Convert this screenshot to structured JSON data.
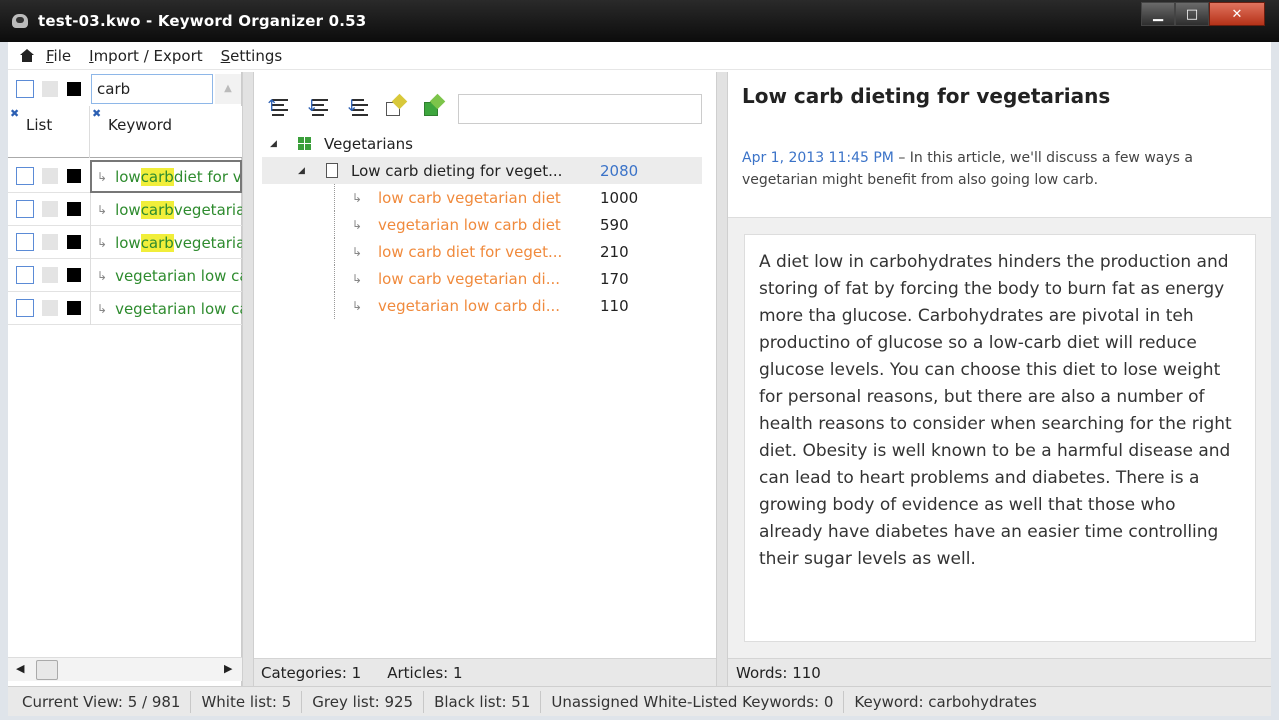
{
  "window": {
    "title": "test-03.kwo - Keyword Organizer 0.53",
    "minimize_glyph": "▁",
    "maximize_glyph": "□",
    "close_glyph": "✕"
  },
  "menu": [
    "File",
    "Import / Export",
    "Settings"
  ],
  "icons": {
    "app": "app-icon",
    "home": "home-icon",
    "sort_asc": "sort-ascending-icon",
    "sort_desc": "sort-descending-icon",
    "sort_numeric": "sort-numeric-icon",
    "add_article": "add-article-icon",
    "add_category": "add-category-icon"
  },
  "left": {
    "filter_value": "carb",
    "columns": {
      "list": "List",
      "keyword": "Keyword"
    },
    "rows": [
      {
        "pre": "low ",
        "hl": "carb",
        "post": " diet for vegetarians",
        "selected": true
      },
      {
        "pre": "low ",
        "hl": "carb",
        "post": " vegetarian diet",
        "selected": false
      },
      {
        "pre": "low ",
        "hl": "carb",
        "post": " vegetarian diets",
        "selected": false
      },
      {
        "pre": "vegetarian low carb diet",
        "hl": "",
        "post": "",
        "selected": false
      },
      {
        "pre": "vegetarian low carb diets",
        "hl": "",
        "post": "",
        "selected": false
      }
    ]
  },
  "middle": {
    "category": "Vegetarians",
    "article": {
      "label": "Low carb dieting for veget...",
      "count": "2080"
    },
    "keywords": [
      {
        "label": "low carb vegetarian diet",
        "count": "1000"
      },
      {
        "label": "vegetarian low carb diet",
        "count": "590"
      },
      {
        "label": "low carb diet for veget...",
        "count": "210"
      },
      {
        "label": "low carb vegetarian di...",
        "count": "170"
      },
      {
        "label": "vegetarian low carb di...",
        "count": "110"
      }
    ],
    "status": {
      "categories": "Categories: 1",
      "articles": "Articles: 1"
    }
  },
  "right": {
    "title": "Low carb dieting for vegetarians",
    "date": "Apr 1, 2013 11:45 PM",
    "summary": " – In this article, we'll discuss a few ways a vegetarian might benefit from also going low carb.",
    "body": "A diet low in carbohydrates hinders the production and storing of fat by forcing the body to burn fat as energy more tha glucose. Carbohydrates are pivotal in teh productino of glucose so a low-carb diet will reduce glucose levels. You can choose this diet to lose weight for personal reasons, but there are also a number of health reasons to consider when searching for the right diet. Obesity is well known to be a harmful disease and can lead to heart problems and diabetes. There is a growing body of evidence as well that those who already have diabetes have an easier time controlling their sugar levels as well.",
    "words": "Words: 110"
  },
  "statusbar": {
    "current_view": "Current View: 5 / 981",
    "white_list": "White list: 5",
    "grey_list": "Grey list: 925",
    "black_list": "Black list: 51",
    "unassigned": "Unassigned White-Listed Keywords: 0",
    "keyword": "Keyword: carbohydrates"
  }
}
